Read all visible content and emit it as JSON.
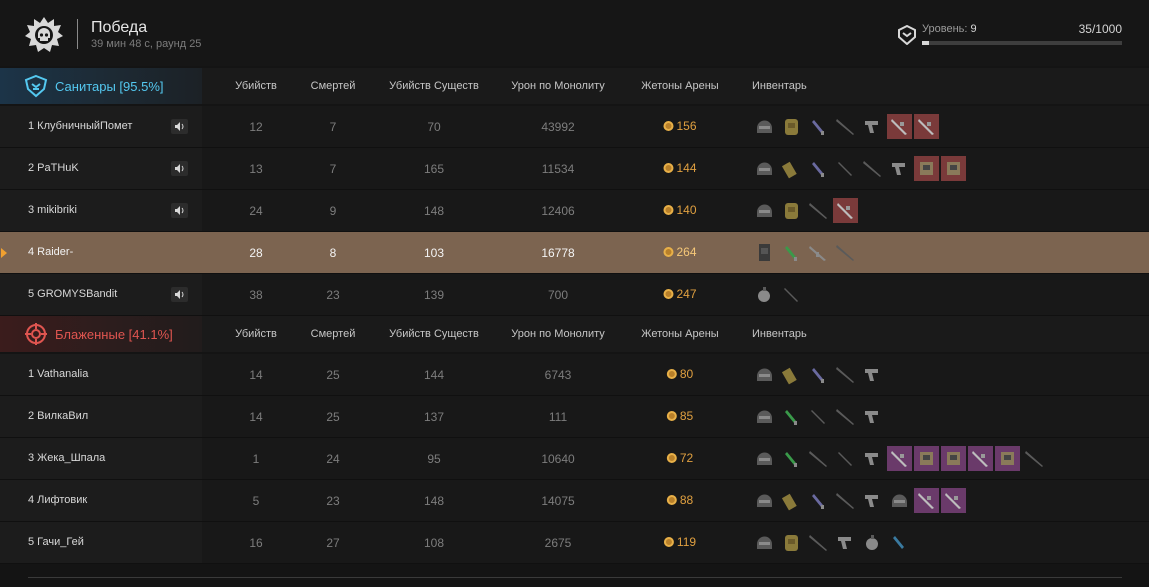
{
  "result": {
    "title": "Победа",
    "subtitle": "39 мин 48 с, раунд 25"
  },
  "level": {
    "label": "Уровень:",
    "value": "9",
    "xp_text": "35/1000",
    "progress": 0.035
  },
  "columns": {
    "kills": "Убийств",
    "deaths": "Смертей",
    "creature_kills": "Убийств Существ",
    "monolith_damage": "Урон по Монолиту",
    "arena_tokens": "Жетоны Арены",
    "inventory": "Инвентарь"
  },
  "teams": [
    {
      "name": "Санитары [95.5%]",
      "color": "#54c8f0",
      "icon": "sanitar-emblem-icon",
      "players": [
        {
          "name": "1 КлубничныйПомет",
          "voice": true,
          "kills": "12",
          "deaths": "7",
          "creature_kills": "70",
          "monolith_damage": "43992",
          "tokens": "156",
          "highlight": false,
          "inventory": [
            "helmet-icon",
            "backpack-icon",
            "syringe-icon",
            "rifle-icon",
            "pistol-icon",
            "rare-weapon-icon",
            "rare-weapon-icon"
          ]
        },
        {
          "name": "2 PaTHuK",
          "voice": true,
          "kills": "13",
          "deaths": "7",
          "creature_kills": "165",
          "monolith_damage": "11534",
          "tokens": "144",
          "highlight": false,
          "inventory": [
            "helmet-icon",
            "ammo-pouch-icon",
            "syringe-icon",
            "knife-icon",
            "rifle-icon",
            "pistol-icon",
            "rare-armor-icon",
            "rare-armor-icon"
          ]
        },
        {
          "name": "3 mikibriki",
          "voice": true,
          "kills": "24",
          "deaths": "9",
          "creature_kills": "148",
          "monolith_damage": "12406",
          "tokens": "140",
          "highlight": false,
          "inventory": [
            "helmet-icon",
            "backpack-icon",
            "rifle-icon",
            "rare-weapon-icon"
          ]
        },
        {
          "name": "4 Raider-",
          "voice": false,
          "kills": "28",
          "deaths": "8",
          "creature_kills": "103",
          "monolith_damage": "16778",
          "tokens": "264",
          "highlight": true,
          "inventory": [
            "armor-vest-icon",
            "green-syringe-icon",
            "assault-rifle-icon",
            "rifle-icon"
          ]
        },
        {
          "name": "5 GROMYSBandit",
          "voice": true,
          "kills": "38",
          "deaths": "23",
          "creature_kills": "139",
          "monolith_damage": "700",
          "tokens": "247",
          "highlight": false,
          "inventory": [
            "grenade-icon",
            "knife-icon"
          ]
        }
      ]
    },
    {
      "name": "Блаженные [41.1%]",
      "color": "#e05550",
      "icon": "blessed-emblem-icon",
      "players": [
        {
          "name": "1 Vathanalia",
          "voice": false,
          "kills": "14",
          "deaths": "25",
          "creature_kills": "144",
          "monolith_damage": "6743",
          "tokens": "80",
          "highlight": false,
          "inventory": [
            "helmet-icon",
            "ammo-pouch-icon",
            "syringe-icon",
            "rifle-icon",
            "pistol-icon"
          ]
        },
        {
          "name": "2 ВилкаВил",
          "voice": false,
          "kills": "14",
          "deaths": "25",
          "creature_kills": "137",
          "monolith_damage": "111",
          "tokens": "85",
          "highlight": false,
          "inventory": [
            "helmet-icon",
            "green-syringe-icon",
            "knife-icon",
            "rifle-icon",
            "pistol-icon"
          ]
        },
        {
          "name": "3 Жека_Шпала",
          "voice": false,
          "kills": "1",
          "deaths": "24",
          "creature_kills": "95",
          "monolith_damage": "10640",
          "tokens": "72",
          "highlight": false,
          "inventory": [
            "helmet-icon",
            "green-syringe-icon",
            "rifle-icon",
            "knife-icon",
            "pistol-icon",
            "epic-weapon-icon",
            "epic-armor-icon",
            "epic-armor-icon",
            "epic-weapon-icon",
            "epic-armor-icon",
            "rifle-icon"
          ]
        },
        {
          "name": "4 Лифтовик",
          "voice": false,
          "kills": "5",
          "deaths": "23",
          "creature_kills": "148",
          "monolith_damage": "14075",
          "tokens": "88",
          "highlight": false,
          "inventory": [
            "helmet-icon",
            "ammo-pouch-icon",
            "syringe-icon",
            "rifle-icon",
            "pistol-icon",
            "helmet-icon",
            "epic-weapon-icon",
            "epic-weapon-icon"
          ]
        },
        {
          "name": "5 Гачи_Гей",
          "voice": false,
          "kills": "16",
          "deaths": "27",
          "creature_kills": "108",
          "monolith_damage": "2675",
          "tokens": "119",
          "highlight": false,
          "inventory": [
            "helmet-icon",
            "backpack-icon",
            "rifle-icon",
            "pistol-icon",
            "grenade-icon",
            "blue-syringe-icon"
          ]
        }
      ]
    }
  ],
  "colors": {
    "highlight_row": "#7c6450",
    "token_gold": "#e0a040",
    "team_blue": "#54c8f0",
    "team_red": "#e05550"
  }
}
